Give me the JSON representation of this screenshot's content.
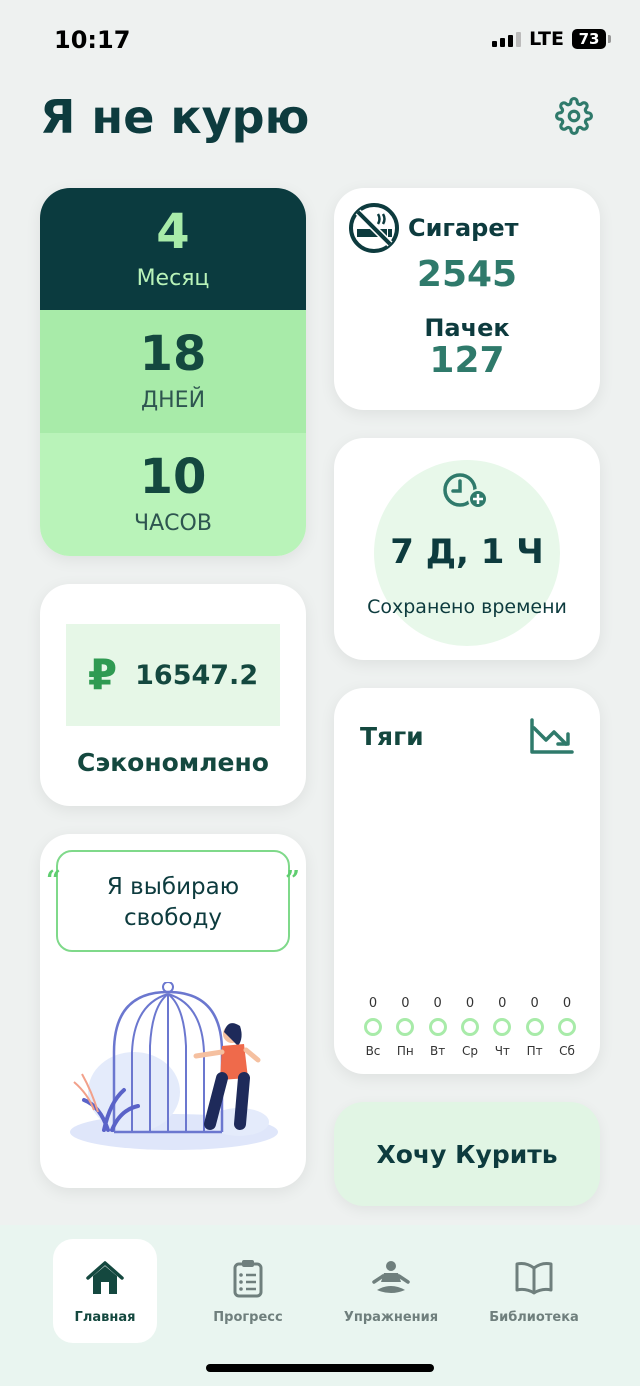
{
  "status_bar": {
    "time": "10:17",
    "network": "LTE",
    "battery": "73"
  },
  "header": {
    "title": "Я не курю",
    "settings_icon": "gear-icon"
  },
  "time_card": {
    "months": "4",
    "months_label": "Месяц",
    "days": "18",
    "days_label": "ДНЕЙ",
    "hours": "10",
    "hours_label": "ЧАСОВ"
  },
  "cigarettes_card": {
    "icon": "no-smoking-icon",
    "cigarettes_label": "Сигарет",
    "cigarettes_value": "2545",
    "packs_label": "Пачек",
    "packs_value": "127"
  },
  "saved_time_card": {
    "icon": "clock-plus-icon",
    "value": "7 Д, 1 Ч",
    "label": "Сохранено времени"
  },
  "money_card": {
    "currency_icon": "₽",
    "value": "16547.2",
    "label": "Сэкономлено"
  },
  "cravings_card": {
    "title": "Тяги",
    "icon": "trend-down-icon",
    "days": [
      {
        "name": "Вс",
        "count": "0"
      },
      {
        "name": "Пн",
        "count": "0"
      },
      {
        "name": "Вт",
        "count": "0"
      },
      {
        "name": "Ср",
        "count": "0"
      },
      {
        "name": "Чт",
        "count": "0"
      },
      {
        "name": "Пт",
        "count": "0"
      },
      {
        "name": "Сб",
        "count": "0"
      }
    ]
  },
  "quote_card": {
    "open_mark": "“",
    "text": "Я выбираю свободу",
    "close_mark": "”",
    "illustration": "woman-leaving-cage-illustration"
  },
  "crave_button": {
    "label": "Хочу Курить"
  },
  "bottom_nav": {
    "items": [
      {
        "label": "Главная",
        "icon": "home-icon",
        "active": true
      },
      {
        "label": "Прогресс",
        "icon": "clipboard-icon",
        "active": false
      },
      {
        "label": "Упражнения",
        "icon": "meditation-icon",
        "active": false
      },
      {
        "label": "Библиотека",
        "icon": "book-icon",
        "active": false
      }
    ]
  },
  "colors": {
    "dark": "#0b3b3f",
    "accent_green": "#a8eba9",
    "teal": "#2f7a6b",
    "light_green": "#e1f5e4"
  }
}
